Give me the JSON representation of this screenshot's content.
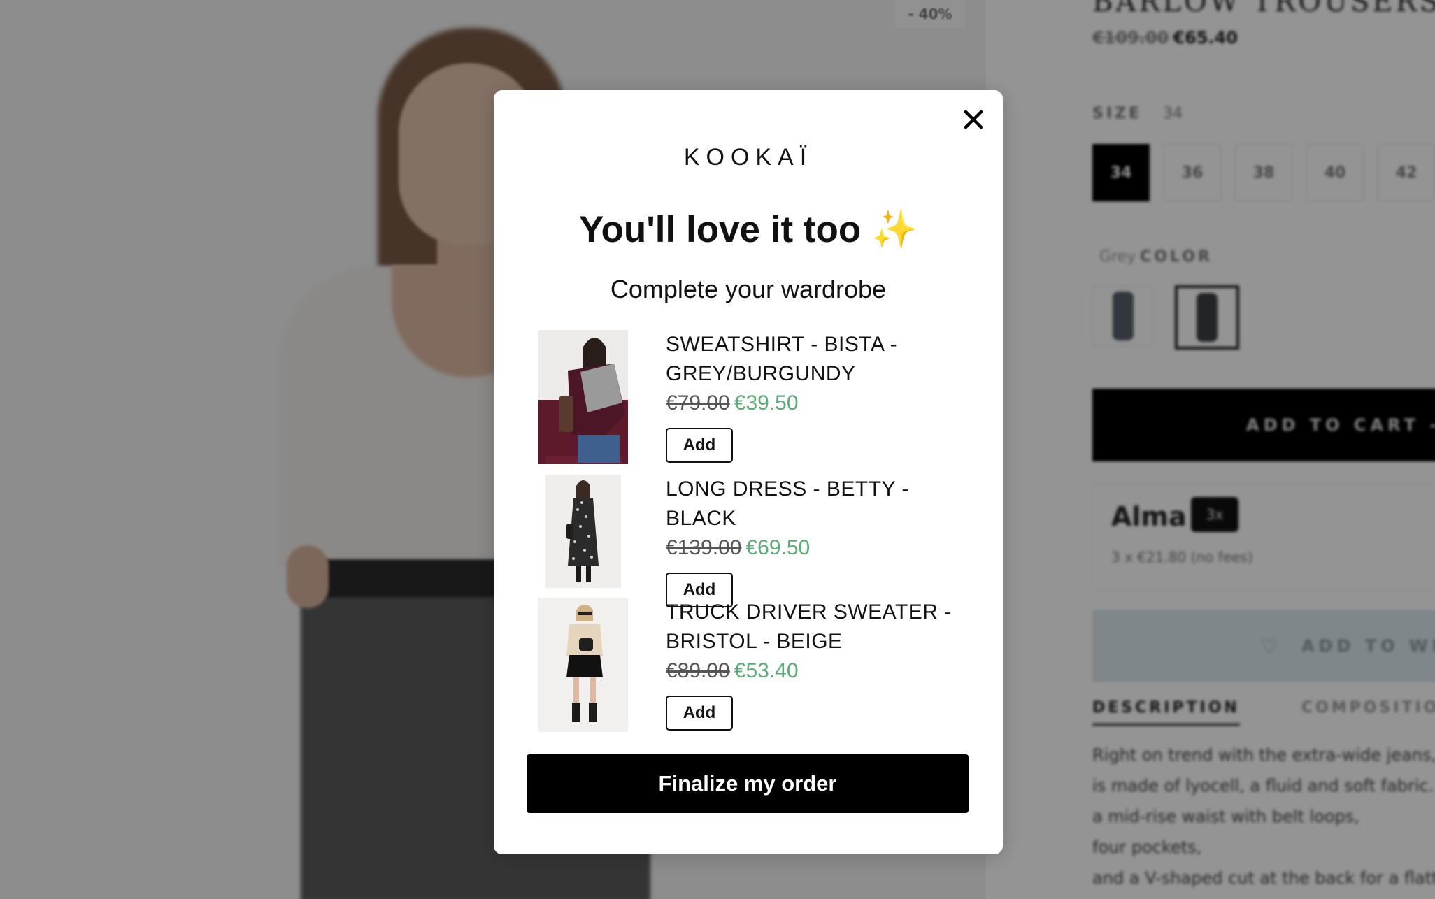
{
  "background": {
    "discount_badge": "- 40%",
    "product_title": "BARLOW TROUSERS",
    "price_old": "€109.00",
    "price_new": "€65.40",
    "size_label": "SIZE",
    "size_selected": "34",
    "sizes": [
      "34",
      "36",
      "38",
      "40",
      "42"
    ],
    "color_value": "Grey",
    "color_label": "COLOR",
    "add_to_cart": "ADD TO CART - €",
    "alma_logo": "Alma",
    "alma_badge": "3x",
    "alma_plan": "3 x €21.80 (no fees)",
    "wishlist": "ADD TO WISH",
    "tab_description": "DESCRIPTION",
    "tab_composition": "COMPOSITION",
    "description_lines": [
      "Right on trend with the extra-wide jeans, Ba",
      "is made of lyocell, a fluid and soft fabric. It fe",
      "a mid-rise waist with belt loops,",
      "four pockets,",
      "and a V-shaped cut at the back for a flatterin"
    ]
  },
  "modal": {
    "brand": "KOOKAÏ",
    "title": "You'll love it too ✨",
    "subtitle": "Complete your wardrobe",
    "close_icon": "close-icon",
    "products": [
      {
        "name": "SWEATSHIRT - BISTA - GREY/BURGUNDY",
        "price_old": "€79.00",
        "price_new": "€39.50",
        "add_label": "Add"
      },
      {
        "name": "LONG DRESS - BETTY - BLACK",
        "price_old": "€139.00",
        "price_new": "€69.50",
        "add_label": "Add"
      },
      {
        "name": "TRUCK DRIVER SWEATER - BRISTOL - BEIGE",
        "price_old": "€89.00",
        "price_new": "€53.40",
        "add_label": "Add"
      }
    ],
    "finalize_label": "Finalize my order"
  },
  "colors": {
    "price_sale": "#5aab75",
    "button_bg": "#000000",
    "overlay": "rgba(0,0,0,0.42)"
  }
}
